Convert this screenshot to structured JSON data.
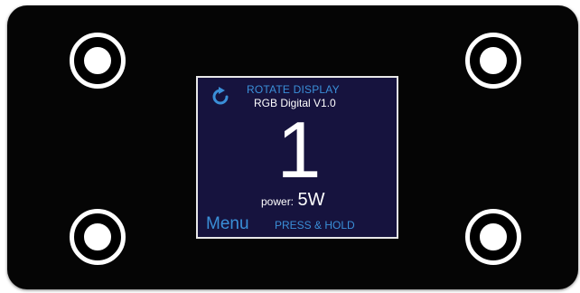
{
  "display": {
    "rotate_label": "ROTATE DISPLAY",
    "model_label": "RGB Digital V1.0",
    "channel_number": "1",
    "power_label": "power:",
    "power_value": "5W",
    "menu_label": "Menu",
    "press_hold_label": "PRESS & HOLD"
  },
  "icons": {
    "rotate": "rotate-icon",
    "screws": [
      "screw-icon",
      "screw-icon",
      "screw-icon",
      "screw-icon"
    ]
  },
  "colors": {
    "panel": "#050505",
    "screen": "#16133e",
    "accent": "#3a8fd8",
    "text": "#ffffff"
  }
}
